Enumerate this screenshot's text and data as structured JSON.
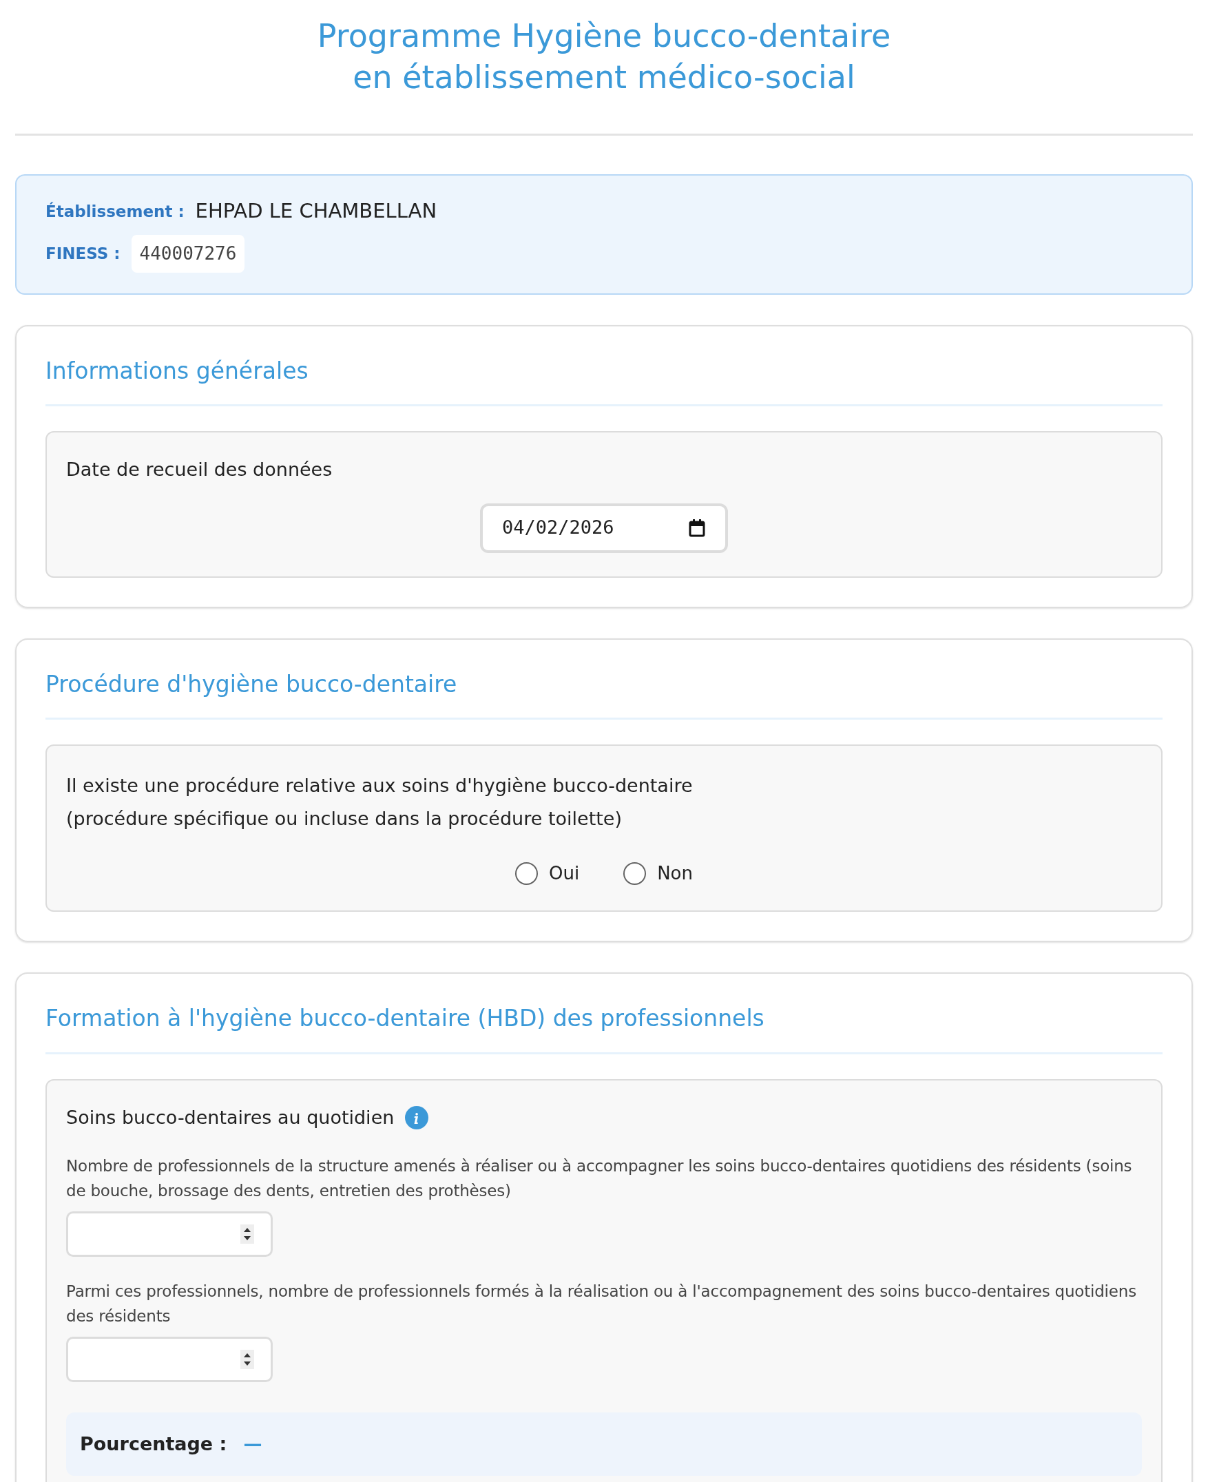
{
  "title": [
    "Programme Hygiène bucco-dentaire",
    "en établissement médico-social"
  ],
  "establishment": {
    "name_label": "Établissement :",
    "name": "EHPAD LE CHAMBELLAN",
    "finess_label": "FINESS :",
    "finess": "440007276"
  },
  "sections": [
    {
      "title": "Informations générales",
      "questions": [
        {
          "kind": "date",
          "label": "Date de recueil des données",
          "value": "04/02/2026"
        }
      ]
    },
    {
      "title": "Procédure d'hygiène bucco-dentaire",
      "questions": [
        {
          "kind": "radio",
          "lines": [
            "Il existe une procédure relative aux soins d'hygiène bucco-dentaire",
            "(procédure spécifique ou incluse dans la procédure toilette)"
          ],
          "options": [
            {
              "label": "Oui",
              "selected": false
            },
            {
              "label": "Non",
              "selected": false
            }
          ]
        }
      ]
    },
    {
      "title": "Formation à l'hygiène bucco-dentaire (HBD) des professionnels",
      "questions": [
        {
          "kind": "group",
          "label": "Soins bucco-dentaires au quotidien",
          "info": true,
          "fields": [
            {
              "label": "Nombre de professionnels de la structure amenés à réaliser ou à accompagner les soins bucco-dentaires quotidiens des résidents (soins de bouche, brossage des dents, entretien des prothèses)"
            },
            {
              "label": "Parmi ces professionnels, nombre de professionnels formés à la réalisation ou à l'accompagnement des soins bucco-dentaires quotidiens des résidents"
            }
          ],
          "result_label": "Pourcentage :",
          "result": "—"
        }
      ]
    }
  ]
}
